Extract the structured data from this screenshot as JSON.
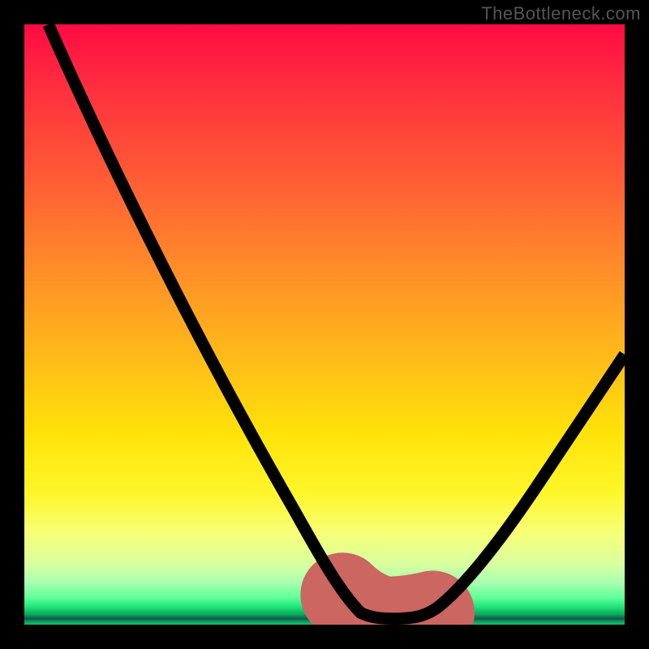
{
  "watermark": "TheBottleneck.com",
  "chart_data": {
    "type": "line",
    "title": "",
    "xlabel": "",
    "ylabel": "",
    "xlim": [
      0,
      100
    ],
    "ylim": [
      0,
      100
    ],
    "grid": false,
    "legend": false,
    "series": [
      {
        "name": "bottleneck-curve",
        "x": [
          0,
          10,
          20,
          30,
          40,
          45,
          50,
          53,
          56,
          60,
          64,
          68,
          72,
          76,
          82,
          90,
          100
        ],
        "values": [
          100,
          82,
          64,
          46,
          28,
          19,
          10,
          5,
          2,
          1,
          1,
          2,
          5,
          10,
          18,
          30,
          45
        ]
      }
    ],
    "highlight_range_x": [
      53,
      68
    ],
    "background_gradient_stops": [
      {
        "pos": 0,
        "color": "#ff0b43"
      },
      {
        "pos": 0.4,
        "color": "#ff8a2a"
      },
      {
        "pos": 0.68,
        "color": "#ffe20a"
      },
      {
        "pos": 0.9,
        "color": "#d8ffa0"
      },
      {
        "pos": 0.97,
        "color": "#20e67a"
      },
      {
        "pos": 1.0,
        "color": "#0dbf60"
      }
    ]
  },
  "icons": {
    "none": ""
  }
}
